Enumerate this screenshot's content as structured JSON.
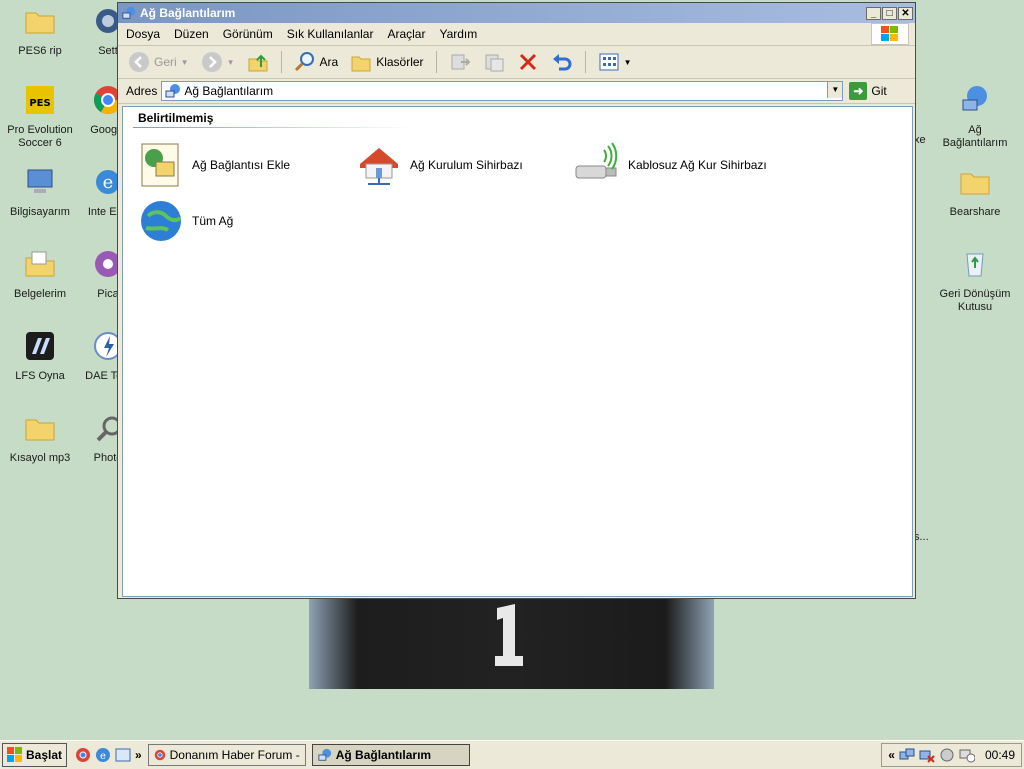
{
  "desktop": {
    "left_icons": [
      {
        "label": "PES6 rip",
        "icon": "folder-icon"
      },
      {
        "label": "Pro Evolution Soccer 6",
        "icon": "pes-icon"
      },
      {
        "label": "Bilgisayarım",
        "icon": "computer-icon"
      },
      {
        "label": "Belgelerim",
        "icon": "documents-icon"
      },
      {
        "label": "LFS Oyna",
        "icon": "lfs-icon"
      },
      {
        "label": "Kısayol mp3",
        "icon": "folder-icon"
      }
    ],
    "mid_icons": [
      {
        "label": "Sett",
        "icon": "camera-icon"
      },
      {
        "label": "Google",
        "icon": "chrome-icon"
      },
      {
        "label": "Inte Exp",
        "icon": "ie-icon"
      },
      {
        "label": "Pica",
        "icon": "picasa-icon"
      },
      {
        "label": "DAE Tool",
        "icon": "daemon-icon"
      },
      {
        "label": "Photo",
        "icon": "photo-icon"
      }
    ],
    "right_icons": [
      {
        "label": "Ağ Bağlantılarım",
        "icon": "network-icon"
      },
      {
        "label": "Bearshare",
        "icon": "folder-icon"
      },
      {
        "label": "Geri Dönüşüm Kutusu",
        "icon": "recycle-bin-icon"
      }
    ],
    "partial_labels": [
      "xe",
      "i",
      "s..."
    ]
  },
  "window": {
    "title": "Ağ Bağlantılarım",
    "menu": [
      "Dosya",
      "Düzen",
      "Görünüm",
      "Sık Kullanılanlar",
      "Araçlar",
      "Yardım"
    ],
    "toolbar": {
      "back": "Geri",
      "search": "Ara",
      "folders": "Klasörler"
    },
    "address": {
      "label": "Adres",
      "value": "Ağ Bağlantılarım",
      "go": "Git"
    },
    "group_header": "Belirtilmemiş",
    "items": [
      {
        "label": "Ağ Bağlantısı Ekle",
        "icon": "add-network-icon"
      },
      {
        "label": "Ağ Kurulum Sihirbazı",
        "icon": "home-network-icon"
      },
      {
        "label": "Kablosuz Ağ Kur Sihirbazı",
        "icon": "wireless-usb-icon"
      },
      {
        "label": "Tüm Ağ",
        "icon": "globe-icon"
      }
    ]
  },
  "taskbar": {
    "start": "Başlat",
    "tasks": [
      {
        "label": "Donanım Haber Forum - G...",
        "active": false
      },
      {
        "label": "Ağ Bağlantılarım",
        "active": true
      }
    ],
    "clock": "00:49"
  }
}
